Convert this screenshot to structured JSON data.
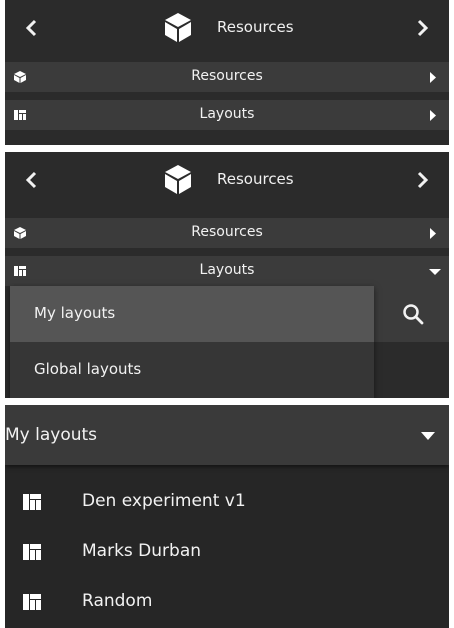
{
  "colors": {
    "panel_bg": "#2b2b2b",
    "row_bg": "#3b3b3b",
    "selected_option_bg": "#555555",
    "text": "#f2f2f2"
  },
  "panel_collapsed": {
    "header": {
      "prev_icon": "chevron-left-icon",
      "title_icon": "cube-icon",
      "title": "Resources",
      "next_icon": "chevron-right-icon"
    },
    "rows": [
      {
        "icon": "cube-icon",
        "label": "Resources",
        "arrow": "caret-right-icon"
      },
      {
        "icon": "layout-icon",
        "label": "Layouts",
        "arrow": "caret-right-icon"
      }
    ]
  },
  "panel_dropdown": {
    "header": {
      "prev_icon": "chevron-left-icon",
      "title_icon": "cube-icon",
      "title": "Resources",
      "next_icon": "chevron-right-icon"
    },
    "rows": [
      {
        "icon": "cube-icon",
        "label": "Resources",
        "arrow": "caret-right-icon"
      },
      {
        "icon": "layout-icon",
        "label": "Layouts",
        "arrow": "caret-down-icon"
      }
    ],
    "options": [
      "My layouts",
      "Global layouts"
    ],
    "selected_option": "My layouts",
    "search_icon": "search-icon"
  },
  "panel_list": {
    "selector_label": "My layouts",
    "selector_icon": "caret-down-icon",
    "items": [
      {
        "icon": "layout-icon",
        "label": "Den experiment v1"
      },
      {
        "icon": "layout-icon",
        "label": "Marks Durban"
      },
      {
        "icon": "layout-icon",
        "label": "Random"
      }
    ]
  }
}
